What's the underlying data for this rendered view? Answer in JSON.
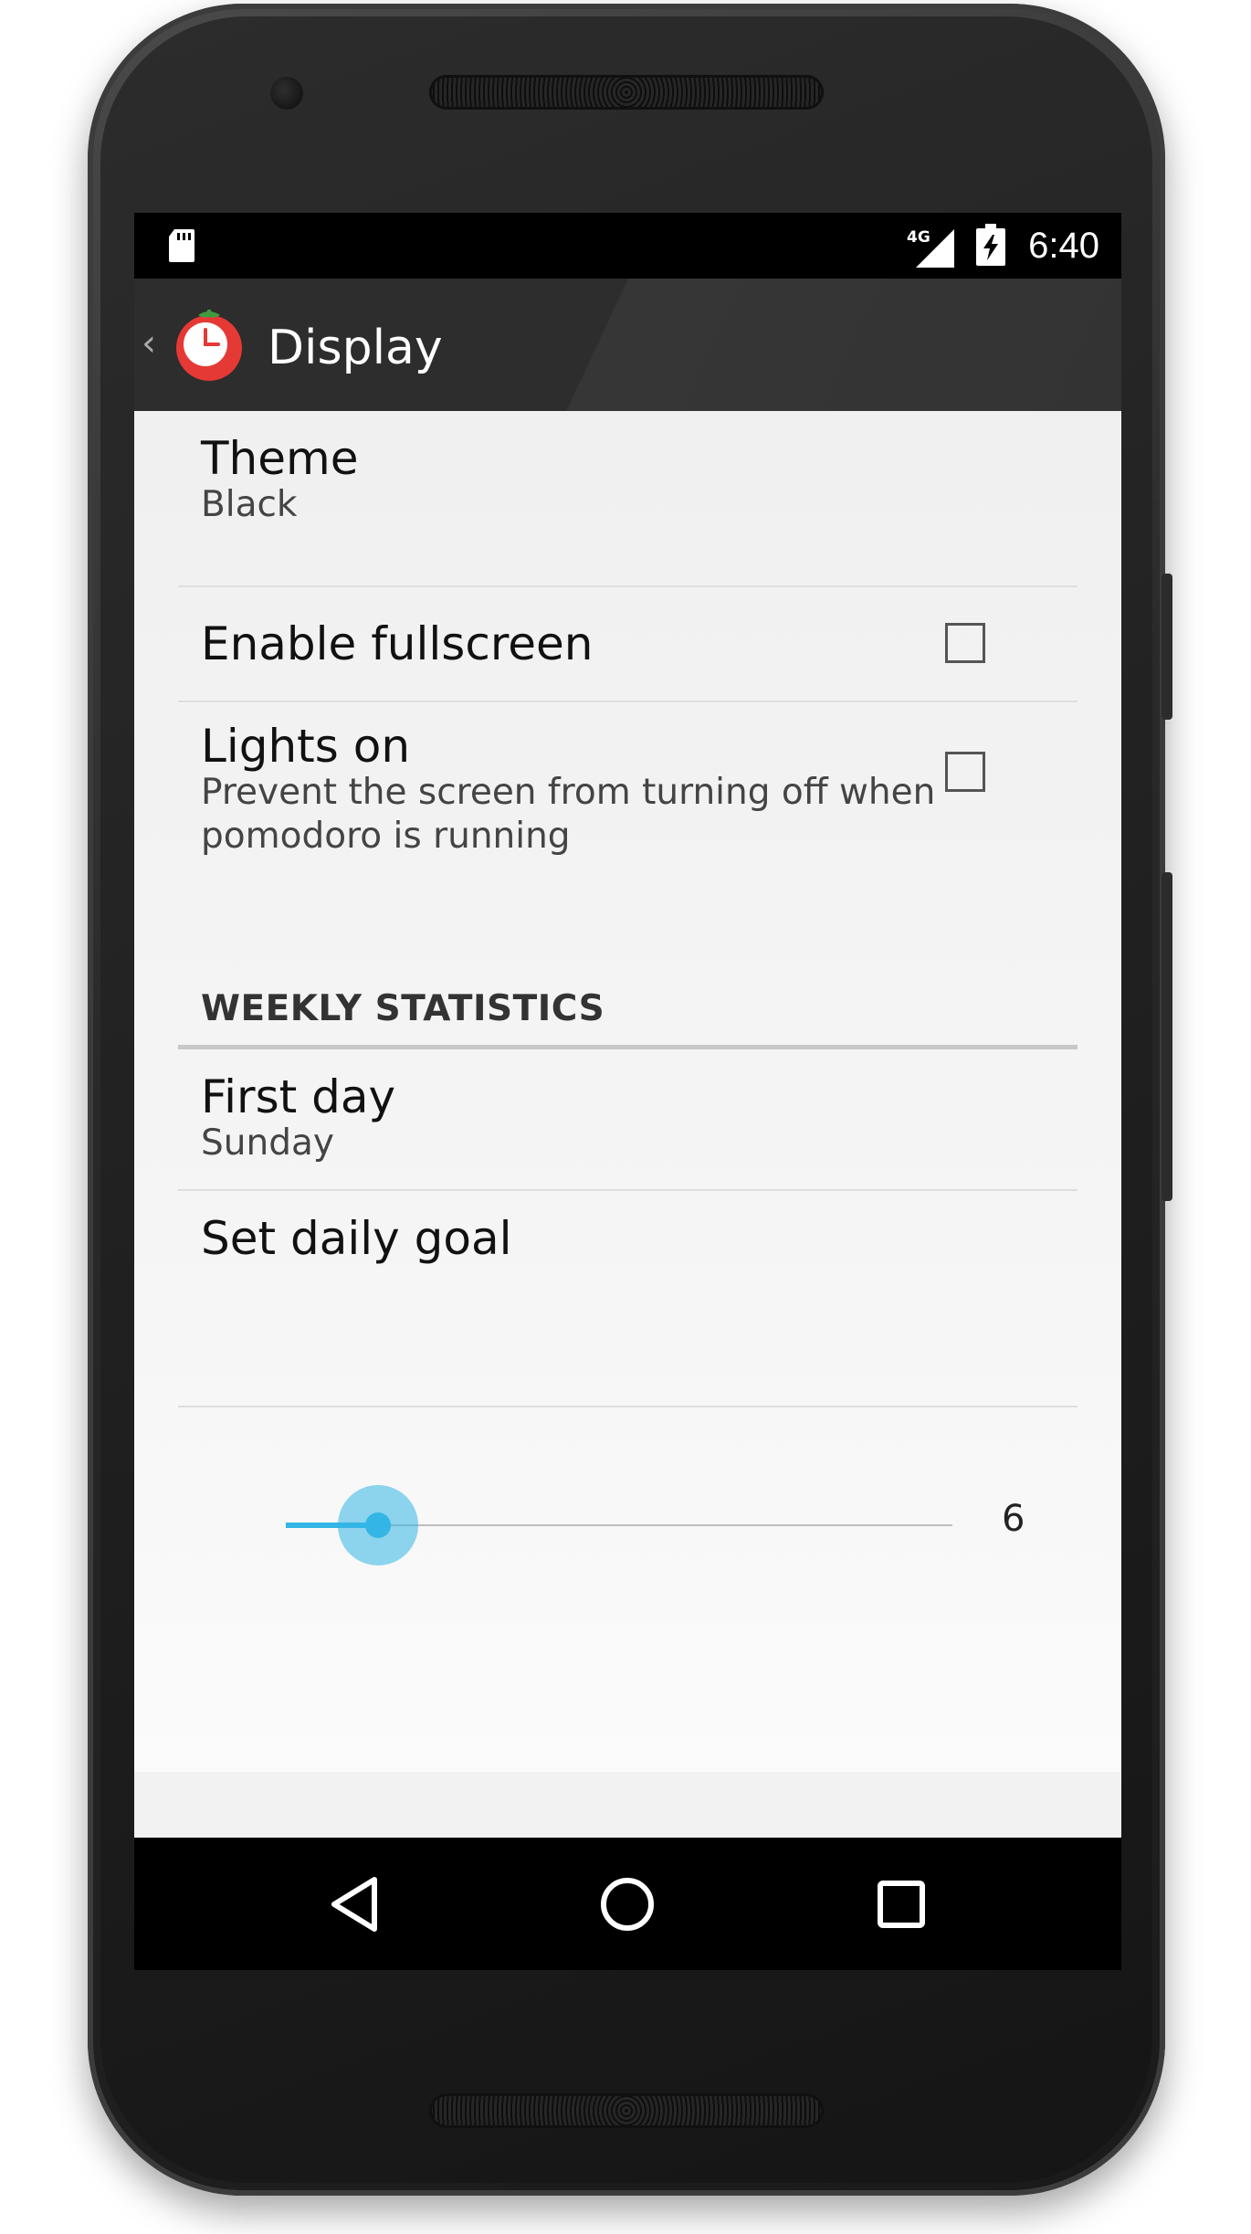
{
  "status_bar": {
    "network": "4G",
    "time": "6:40"
  },
  "action_bar": {
    "title": "Display"
  },
  "prefs": {
    "theme": {
      "title": "Theme",
      "summary": "Black"
    },
    "fullscreen": {
      "title": "Enable fullscreen",
      "checked": false
    },
    "lights_on": {
      "title": "Lights on",
      "summary_line1": "Prevent the screen from turning off when",
      "summary_line2": "pomodoro is running",
      "checked": false
    }
  },
  "weekly_statistics": {
    "header": "WEEKLY STATISTICS",
    "first_day": {
      "title": "First day",
      "summary": "Sunday"
    },
    "daily_goal": {
      "title": "Set daily goal",
      "value": "6"
    }
  },
  "colors": {
    "accent": "#33b5e5",
    "tomato": "#e53935",
    "action_bar": "#2d2d2d"
  },
  "icons": [
    "sd-card-icon",
    "signal-icon",
    "battery-icon",
    "back-icon",
    "pomodoro-app-icon",
    "nav-back-icon",
    "nav-home-icon",
    "nav-recents-icon"
  ]
}
